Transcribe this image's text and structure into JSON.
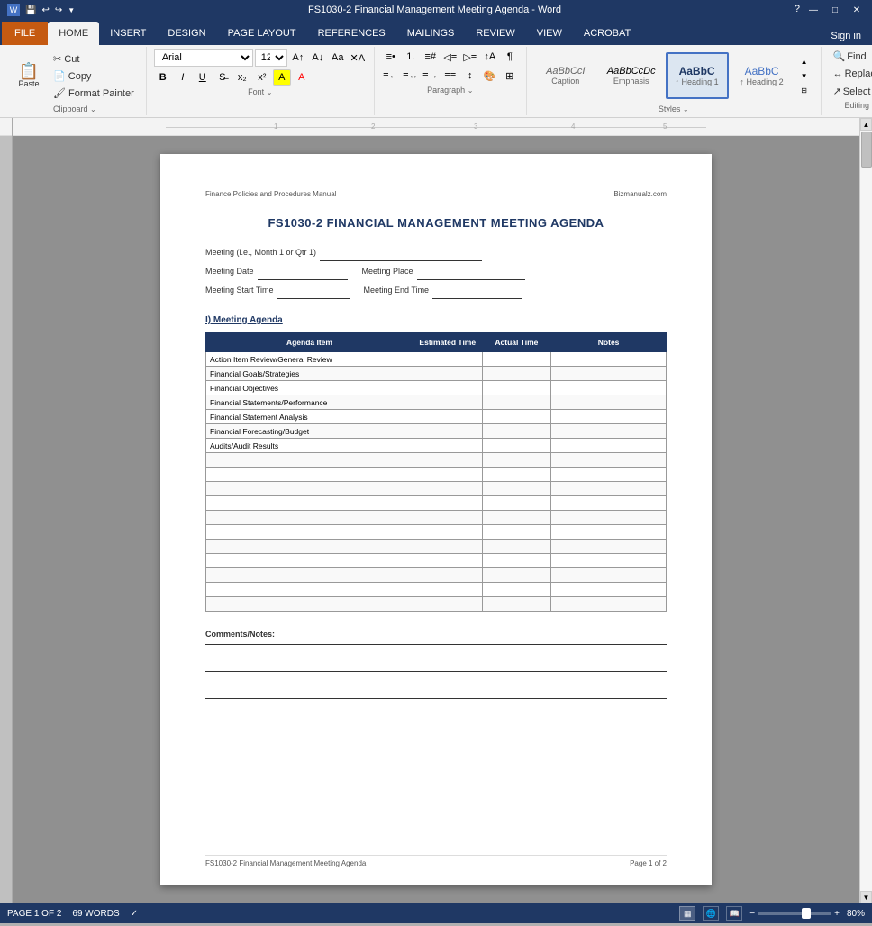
{
  "titlebar": {
    "title": "FS1030-2 Financial Management Meeting Agenda - Word",
    "help_icon": "?",
    "minimize": "—",
    "restore": "□",
    "close": "✕"
  },
  "ribbon": {
    "tabs": [
      "FILE",
      "HOME",
      "INSERT",
      "DESIGN",
      "PAGE LAYOUT",
      "REFERENCES",
      "MAILINGS",
      "REVIEW",
      "VIEW",
      "ACROBAT"
    ],
    "active_tab": "HOME",
    "sign_in": "Sign in",
    "font": {
      "name": "Arial",
      "size": "12",
      "grow": "A",
      "shrink": "a"
    },
    "styles": [
      {
        "label": "AaBbCcI",
        "name": "Caption",
        "sub": "Caption"
      },
      {
        "label": "AaBbCcDc",
        "name": "Emphasis",
        "sub": "Emphasis"
      },
      {
        "label": "AaBbC",
        "name": "Heading 1",
        "sub": "↑ Heading 1"
      },
      {
        "label": "AaBbC",
        "name": "Heading 2",
        "sub": "↑ Heading 2"
      }
    ],
    "editing": {
      "find_label": "Find",
      "replace_label": "Replace",
      "select_label": "Select ="
    }
  },
  "document": {
    "header_left": "Finance Policies and Procedures Manual",
    "header_right": "Bizmanualz.com",
    "title": "FS1030-2 FINANCIAL MANAGEMENT MEETING AGENDA",
    "meeting_line1_label": "Meeting (i.e., Month 1 or Qtr 1)",
    "meeting_date_label": "Meeting Date",
    "meeting_place_label": "Meeting Place",
    "meeting_start_label": "Meeting Start Time",
    "meeting_end_label": "Meeting End Time",
    "section1_title": "I) Meeting Agenda",
    "table": {
      "headers": [
        "Agenda Item",
        "Estimated Time",
        "Actual Time",
        "Notes"
      ],
      "rows": [
        {
          "item": "Action Item Review/General Review",
          "est": "",
          "act": "",
          "notes": ""
        },
        {
          "item": "Financial Goals/Strategies",
          "est": "",
          "act": "",
          "notes": ""
        },
        {
          "item": "Financial Objectives",
          "est": "",
          "act": "",
          "notes": ""
        },
        {
          "item": "Financial Statements/Performance",
          "est": "",
          "act": "",
          "notes": ""
        },
        {
          "item": "Financial Statement Analysis",
          "est": "",
          "act": "",
          "notes": ""
        },
        {
          "item": "Financial Forecasting/Budget",
          "est": "",
          "act": "",
          "notes": ""
        },
        {
          "item": "Audits/Audit Results",
          "est": "",
          "act": "",
          "notes": ""
        },
        {
          "item": "",
          "est": "",
          "act": "",
          "notes": ""
        },
        {
          "item": "",
          "est": "",
          "act": "",
          "notes": ""
        },
        {
          "item": "",
          "est": "",
          "act": "",
          "notes": ""
        },
        {
          "item": "",
          "est": "",
          "act": "",
          "notes": ""
        },
        {
          "item": "",
          "est": "",
          "act": "",
          "notes": ""
        },
        {
          "item": "",
          "est": "",
          "act": "",
          "notes": ""
        },
        {
          "item": "",
          "est": "",
          "act": "",
          "notes": ""
        },
        {
          "item": "",
          "est": "",
          "act": "",
          "notes": ""
        },
        {
          "item": "",
          "est": "",
          "act": "",
          "notes": ""
        },
        {
          "item": "",
          "est": "",
          "act": "",
          "notes": ""
        },
        {
          "item": "",
          "est": "",
          "act": "",
          "notes": ""
        }
      ]
    },
    "comments_label": "Comments/Notes:",
    "comment_lines": 5,
    "footer_left": "FS1030-2 Financial Management Meeting Agenda",
    "footer_right": "Page 1 of 2"
  },
  "statusbar": {
    "page_info": "PAGE 1 OF 2",
    "word_count": "69 WORDS",
    "zoom": "80%",
    "view_icons": [
      "print-layout",
      "web-layout",
      "read-mode"
    ]
  }
}
